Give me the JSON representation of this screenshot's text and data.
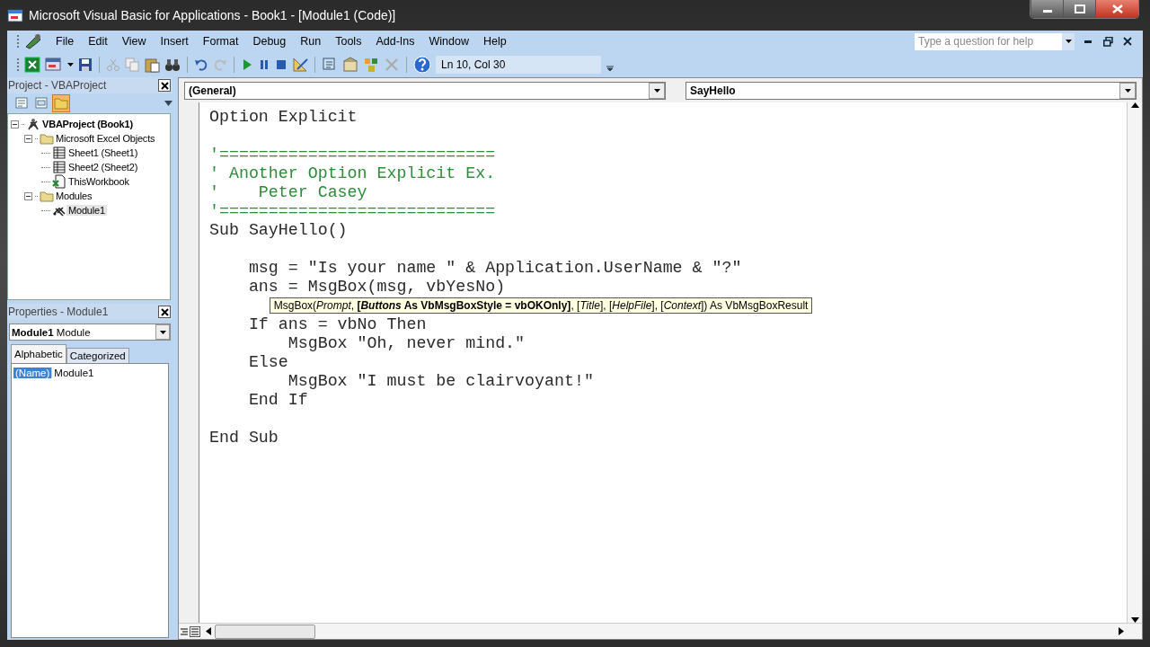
{
  "window": {
    "title": "Microsoft Visual Basic for Applications - Book1 - [Module1 (Code)]"
  },
  "menu": [
    {
      "label": "File"
    },
    {
      "label": "Edit"
    },
    {
      "label": "View"
    },
    {
      "label": "Insert"
    },
    {
      "label": "Format"
    },
    {
      "label": "Debug"
    },
    {
      "label": "Run"
    },
    {
      "label": "Tools"
    },
    {
      "label": "Add-Ins"
    },
    {
      "label": "Window"
    },
    {
      "label": "Help"
    }
  ],
  "help_search": {
    "placeholder": "Type a question for help"
  },
  "toolbar": {
    "position": "Ln 10, Col 30"
  },
  "project_panel": {
    "title": "Project - VBAProject",
    "view_buttons": [
      {
        "kind": "view-code",
        "selected": false
      },
      {
        "kind": "view-object",
        "selected": false
      },
      {
        "kind": "toggle-folders",
        "selected": true
      }
    ],
    "tree": [
      {
        "label": "VBAProject (Book1)",
        "kind": "project",
        "expanded": true,
        "selected": false,
        "children": [
          {
            "label": "Microsoft Excel Objects",
            "kind": "folder",
            "expanded": true,
            "selected": false,
            "children": [
              {
                "label": "Sheet1 (Sheet1)",
                "kind": "sheet",
                "selected": false
              },
              {
                "label": "Sheet2 (Sheet2)",
                "kind": "sheet",
                "selected": false
              },
              {
                "label": "ThisWorkbook",
                "kind": "workbook",
                "selected": false
              }
            ]
          },
          {
            "label": "Modules",
            "kind": "folder",
            "expanded": true,
            "selected": false,
            "children": [
              {
                "label": "Module1",
                "kind": "module",
                "selected": true
              }
            ]
          }
        ]
      }
    ]
  },
  "properties_panel": {
    "title": "Properties - Module1",
    "object_name": "Module1",
    "object_type": "Module",
    "tabs": [
      {
        "label": "Alphabetic",
        "selected": true
      },
      {
        "label": "Categorized",
        "selected": false
      }
    ],
    "rows": [
      {
        "name": "(Name)",
        "value": "Module1",
        "selected": true
      }
    ]
  },
  "code_window": {
    "object": "(General)",
    "procedure": "SayHello",
    "lines": [
      {
        "kind": "code",
        "text": "Option Explicit"
      },
      {
        "kind": "blank"
      },
      {
        "kind": "comment",
        "text": "'============================"
      },
      {
        "kind": "comment",
        "text": "' Another Option Explicit Ex."
      },
      {
        "kind": "comment",
        "text": "'    Peter Casey"
      },
      {
        "kind": "comment",
        "text": "'============================"
      },
      {
        "kind": "code",
        "text": "Sub SayHello()"
      },
      {
        "kind": "blank"
      },
      {
        "kind": "code",
        "text": "    msg = \"Is your name \" & Application.UserName & \"?\""
      },
      {
        "kind": "code",
        "text": "    ans = MsgBox(msg, vbYesNo)"
      },
      {
        "kind": "signature",
        "segments": [
          {
            "text": "MsgBox(",
            "bold": false,
            "italic": false
          },
          {
            "text": "Prompt",
            "bold": false,
            "italic": true
          },
          {
            "text": ", ",
            "bold": false,
            "italic": false
          },
          {
            "text": "[",
            "bold": true,
            "italic": false
          },
          {
            "text": "Buttons",
            "bold": true,
            "italic": true
          },
          {
            "text": " As VbMsgBoxStyle = vbOKOnly]",
            "bold": true,
            "italic": false
          },
          {
            "text": ", [",
            "bold": false,
            "italic": false
          },
          {
            "text": "Title",
            "bold": false,
            "italic": true
          },
          {
            "text": "], [",
            "bold": false,
            "italic": false
          },
          {
            "text": "HelpFile",
            "bold": false,
            "italic": true
          },
          {
            "text": "], [",
            "bold": false,
            "italic": false
          },
          {
            "text": "Context",
            "bold": false,
            "italic": true
          },
          {
            "text": "]) As VbMsgBoxResult",
            "bold": false,
            "italic": false
          }
        ]
      },
      {
        "kind": "code",
        "text": "    If ans = vbNo Then"
      },
      {
        "kind": "code",
        "text": "        MsgBox \"Oh, never mind.\""
      },
      {
        "kind": "code",
        "text": "    Else"
      },
      {
        "kind": "code",
        "text": "        MsgBox \"I must be clairvoyant!\""
      },
      {
        "kind": "code",
        "text": "    End If"
      },
      {
        "kind": "blank"
      },
      {
        "kind": "code",
        "text": "End Sub"
      }
    ]
  }
}
